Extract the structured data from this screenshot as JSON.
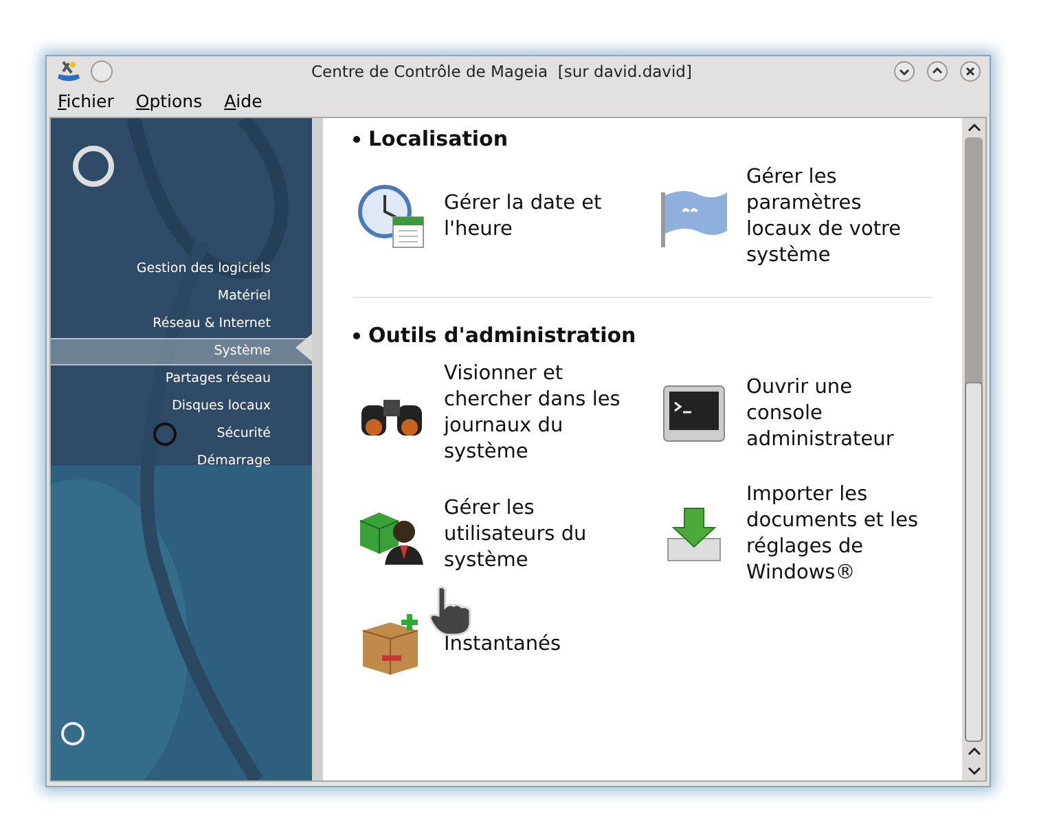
{
  "window": {
    "title": "Centre de Contrôle de Mageia  [sur david.david]"
  },
  "menu": [
    {
      "label": "Fichier"
    },
    {
      "label": "Options"
    },
    {
      "label": "Aide"
    }
  ],
  "sidebar": {
    "items": [
      {
        "label": "Gestion des logiciels",
        "selected": false
      },
      {
        "label": "Matériel",
        "selected": false
      },
      {
        "label": "Réseau & Internet",
        "selected": false
      },
      {
        "label": "Système",
        "selected": true
      },
      {
        "label": "Partages réseau",
        "selected": false
      },
      {
        "label": "Disques locaux",
        "selected": false
      },
      {
        "label": "Sécurité",
        "selected": false
      },
      {
        "label": "Démarrage",
        "selected": false
      }
    ]
  },
  "sections": [
    {
      "title": "Localisation",
      "items": [
        {
          "kind": "clock",
          "label": "Gérer la date et l'heure"
        },
        {
          "kind": "flag",
          "label": "Gérer les paramètres locaux de votre système"
        }
      ]
    },
    {
      "title": "Outils d'administration",
      "items": [
        {
          "kind": "binoculars",
          "label": "Visionner et chercher dans les journaux du système"
        },
        {
          "kind": "terminal",
          "label": "Ouvrir une console administrateur"
        },
        {
          "kind": "user",
          "label": "Gérer les utilisateurs du système"
        },
        {
          "kind": "download",
          "label": "Importer les documents et les réglages de Windows®"
        },
        {
          "kind": "box",
          "label": "Instantanés"
        }
      ]
    }
  ]
}
